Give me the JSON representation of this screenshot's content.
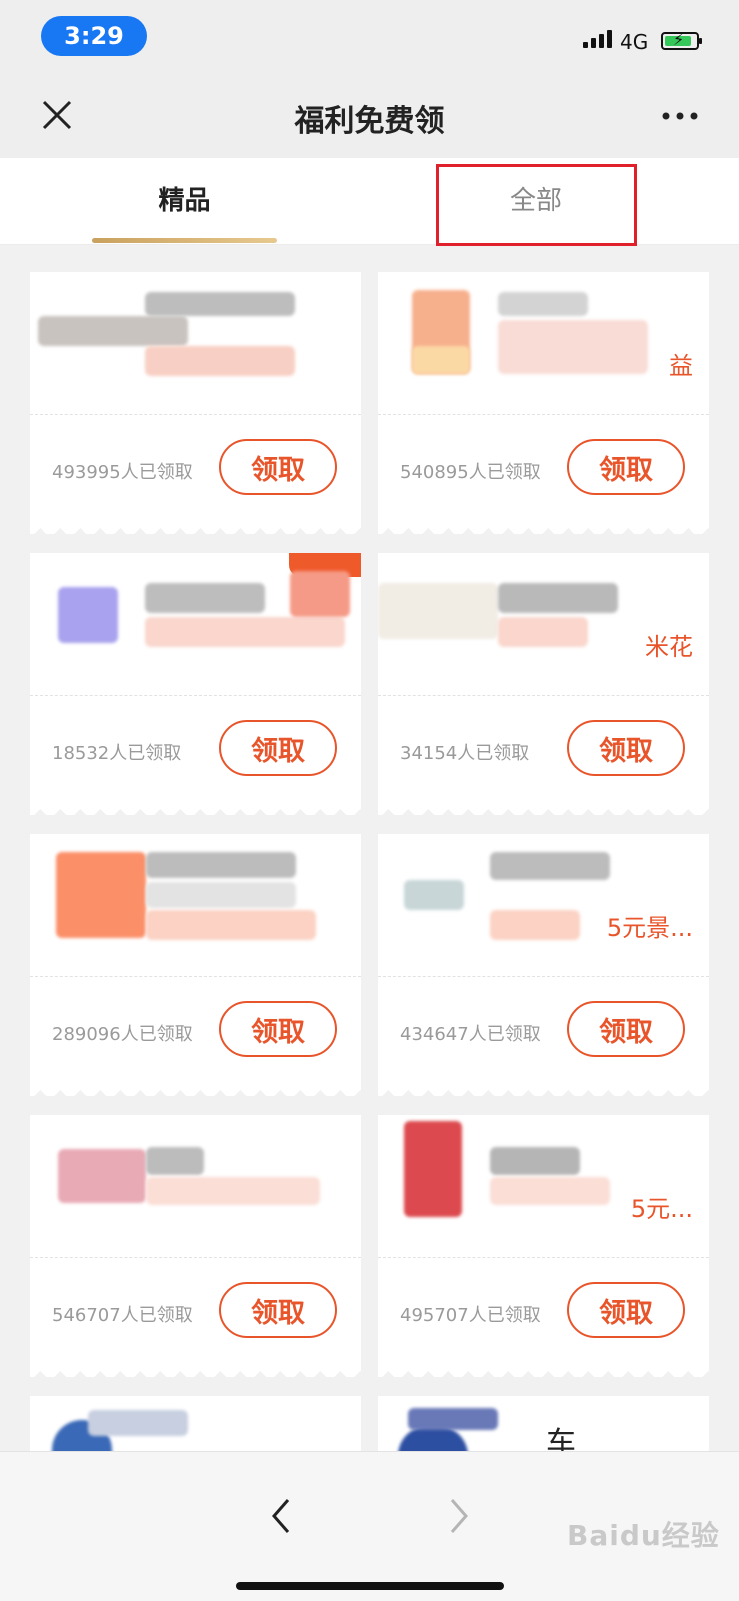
{
  "status_bar": {
    "time": "3:29",
    "network": "4G"
  },
  "header": {
    "title": "福利免费领"
  },
  "tabs": [
    {
      "label": "精品",
      "active": true
    },
    {
      "label": "全部",
      "active": false
    }
  ],
  "cards": [
    {
      "subtitle": "",
      "count": "493995人已领取",
      "button": "领取"
    },
    {
      "subtitle": "益",
      "count": "540895人已领取",
      "button": "领取"
    },
    {
      "subtitle": "",
      "count": "18532人已领取",
      "button": "领取"
    },
    {
      "subtitle": "米花",
      "count": "34154人已领取",
      "button": "领取"
    },
    {
      "subtitle": "",
      "count": "289096人已领取",
      "button": "领取"
    },
    {
      "subtitle": "5元景...",
      "count": "434647人已领取",
      "button": "领取"
    },
    {
      "subtitle": "",
      "count": "546707人已领取",
      "button": "领取"
    },
    {
      "subtitle": "5元...",
      "count": "495707人已领取",
      "button": "领取"
    }
  ],
  "partial_cards": [
    {
      "text": ""
    },
    {
      "text": "车"
    }
  ],
  "watermark": "Baidu经验",
  "colors": {
    "accent": "#e8552b",
    "highlight_box": "#e0202a",
    "status_pill": "#1877f2"
  }
}
